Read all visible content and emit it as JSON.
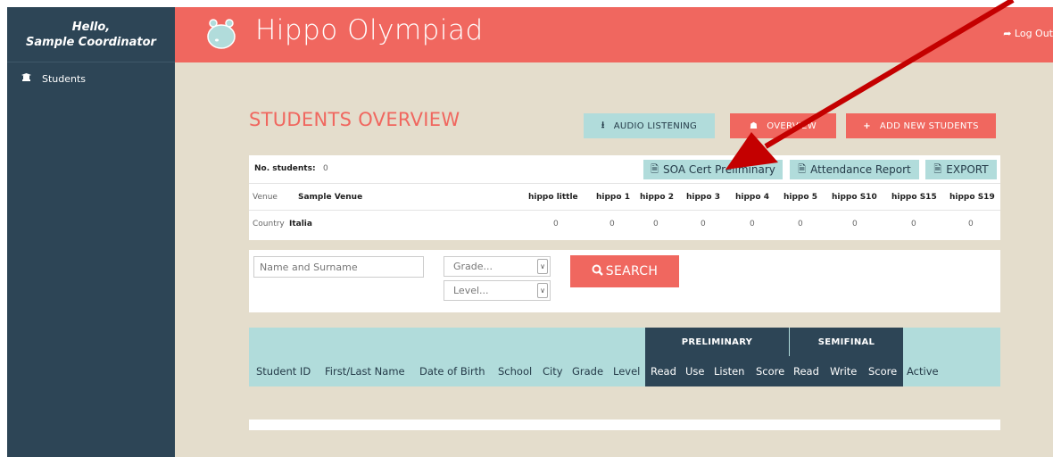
{
  "sidebar": {
    "greeting": "Hello,",
    "user": "Sample Coordinator",
    "items": [
      {
        "label": "Students",
        "icon": "graduation-cap-icon"
      }
    ]
  },
  "header": {
    "title": "Hippo Olympiad",
    "logout": "Log Out",
    "logo_icon": "hippo-logo-icon"
  },
  "page": {
    "title": "STUDENTS OVERVIEW",
    "buttons": {
      "audio": "AUDIO LISTENING",
      "overview": "OVERVIEW",
      "add": "ADD NEW STUDENTS"
    }
  },
  "summary": {
    "students_label": "No. students:",
    "students_count": "0",
    "soa_cert": "SOA Cert Preliminary",
    "attendance": "Attendance Report",
    "export": "EXPORT",
    "venue_label": "Venue",
    "venue_value": "Sample Venue",
    "country_label": "Country",
    "country_value": "Italia",
    "levels": [
      "hippo little",
      "hippo 1",
      "hippo 2",
      "hippo 3",
      "hippo 4",
      "hippo 5",
      "hippo S10",
      "hippo S15",
      "hippo S19"
    ],
    "counts": [
      "0",
      "0",
      "0",
      "0",
      "0",
      "0",
      "0",
      "0",
      "0"
    ]
  },
  "filters": {
    "name_placeholder": "Name and Surname",
    "grade": "Grade...",
    "level": "Level...",
    "search": "SEARCH"
  },
  "table": {
    "group_preliminary": "PRELIMINARY",
    "group_semifinal": "SEMIFINAL",
    "columns": [
      "Student ID",
      "First/Last Name",
      "Date of Birth",
      "School",
      "City",
      "Grade",
      "Level",
      "Read",
      "Use",
      "Listen",
      "Score",
      "Read",
      "Write",
      "Score",
      "Active"
    ]
  },
  "colors": {
    "accent": "#f0675f",
    "sidebar": "#2d4556",
    "teal": "#b1dcdb",
    "background": "#e4ddcc",
    "arrow": "#c40000"
  }
}
